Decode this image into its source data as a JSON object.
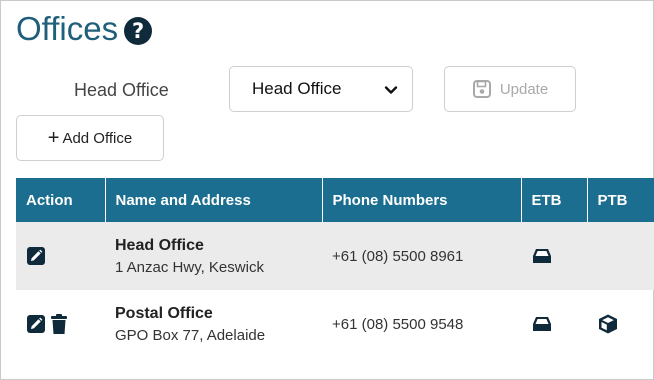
{
  "page": {
    "title": "Offices",
    "help_icon": "question-circle-icon"
  },
  "controls": {
    "head_office_label": "Head Office",
    "head_office_select_value": "Head Office",
    "update_label": "Update",
    "add_office_label": "Add Office"
  },
  "table": {
    "headers": [
      "Action",
      "Name and Address",
      "Phone Numbers",
      "ETB",
      "PTB"
    ],
    "rows": [
      {
        "name": "Head Office",
        "address": "1 Anzac Hwy, Keswick",
        "phone": "+61 (08) 5500 8961",
        "actions": [
          "edit-icon"
        ],
        "etb": "inbox-icon",
        "ptb": ""
      },
      {
        "name": "Postal Office",
        "address": "GPO Box 77, Adelaide",
        "phone": "+61 (08) 5500 9548",
        "actions": [
          "edit-icon",
          "trash-icon"
        ],
        "etb": "inbox-icon",
        "ptb": "package-icon"
      }
    ]
  },
  "colors": {
    "title": "#1f5f7a",
    "header_bg": "#1b6e8f",
    "row_alt_bg": "#ebebeb",
    "icon": "#0f2a3a"
  }
}
